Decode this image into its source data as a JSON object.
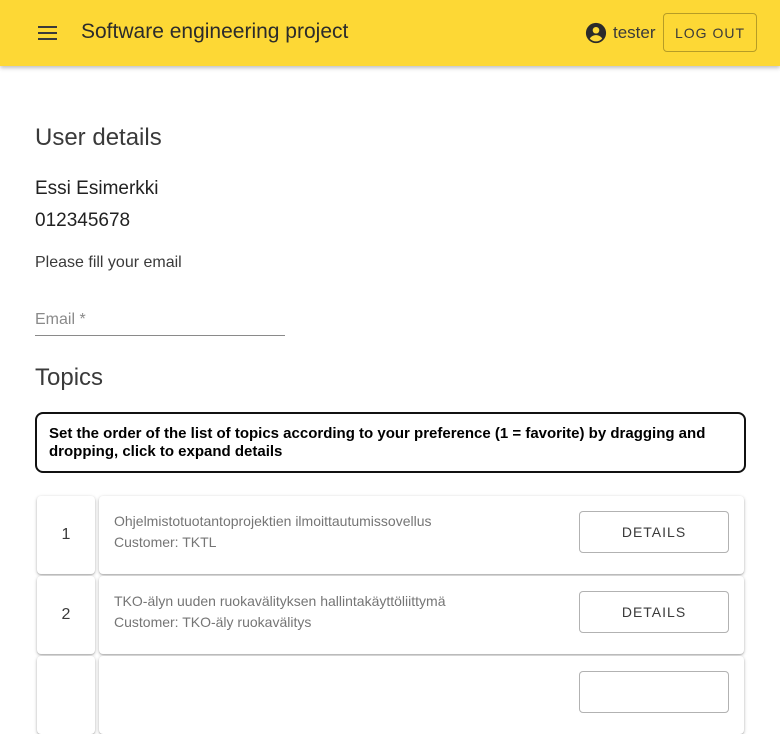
{
  "header": {
    "title": "Software engineering project",
    "username": "tester",
    "logout_label": "LOG OUT",
    "menu_icon": "menu-icon",
    "account_icon": "account-circle-icon",
    "background_color": "#fdd835"
  },
  "user_details": {
    "heading": "User details",
    "name": "Essi Esimerkki",
    "student_number": "012345678",
    "email_prompt": "Please fill your email",
    "email_label": "Email *",
    "email_value": ""
  },
  "topics": {
    "heading": "Topics",
    "instruction": "Set the order of the list of topics according to your preference (1 = favorite) by dragging and dropping, click to expand details",
    "details_label": "DETAILS",
    "items": [
      {
        "rank": "1",
        "name": "Ohjelmistotuotantoprojektien ilmoittautumissovellus",
        "customer": "Customer: TKTL"
      },
      {
        "rank": "2",
        "name": "TKO-älyn uuden ruokavälityksen hallintakäyttöliittymä",
        "customer": "Customer: TKO-äly ruokavälitys"
      }
    ]
  }
}
